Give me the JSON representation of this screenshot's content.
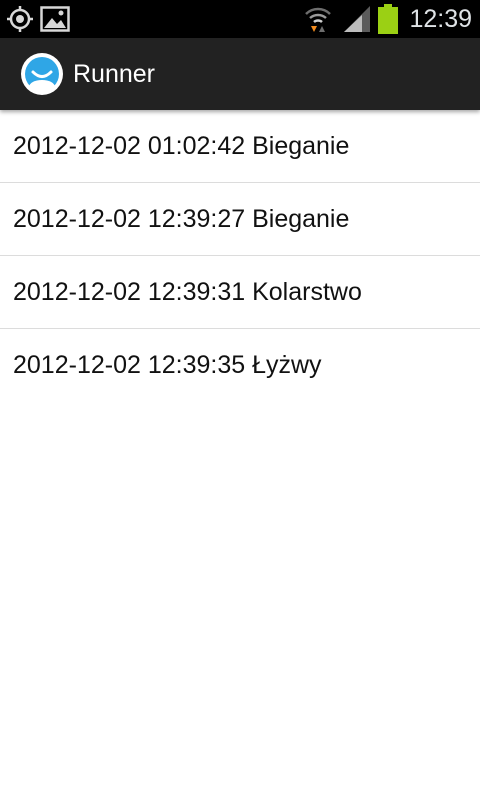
{
  "status_bar": {
    "time": "12:39",
    "icons": [
      "gps-icon",
      "gallery-icon",
      "wifi-icon",
      "signal-icon",
      "battery-icon"
    ],
    "battery_color": "#9bd014"
  },
  "action_bar": {
    "title": "Runner",
    "icon": "runner-app-icon",
    "background": "#222222"
  },
  "activities": [
    {
      "label": "2012-12-02 01:02:42 Bieganie"
    },
    {
      "label": "2012-12-02 12:39:27 Bieganie"
    },
    {
      "label": "2012-12-02 12:39:31 Kolarstwo"
    },
    {
      "label": "2012-12-02 12:39:35 Łyżwy"
    }
  ]
}
